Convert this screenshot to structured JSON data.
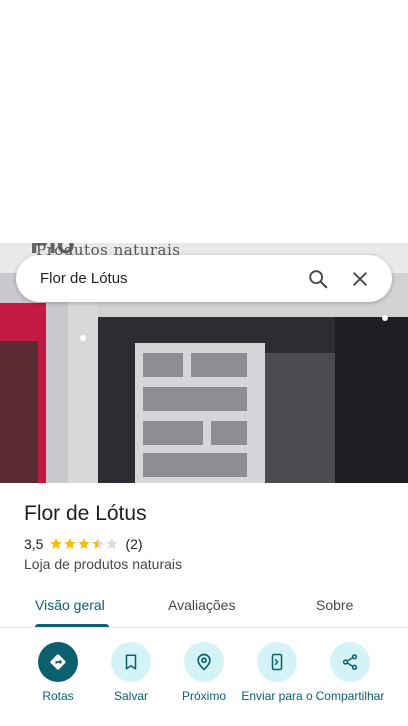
{
  "search": {
    "query": "Flor de Lótus"
  },
  "photo": {
    "sign_text": "Produtos naturais"
  },
  "place": {
    "name": "Flor de Lótus",
    "rating": "3,5",
    "rating_value": 3.5,
    "reviews_count": "(2)",
    "category": "Loja de produtos naturais"
  },
  "tabs": [
    {
      "label": "Visão geral",
      "active": true
    },
    {
      "label": "Avaliações",
      "active": false
    },
    {
      "label": "Sobre",
      "active": false
    }
  ],
  "actions": [
    {
      "label": "Rotas",
      "icon": "directions-icon"
    },
    {
      "label": "Salvar",
      "icon": "bookmark-icon"
    },
    {
      "label": "Próximo",
      "icon": "nearby-icon"
    },
    {
      "label": "Enviar para o",
      "icon": "send-to-phone-icon"
    },
    {
      "label": "Compartilhar",
      "icon": "share-icon"
    }
  ],
  "colors": {
    "accent": "#0b5f6e",
    "accent_light": "#d3f3f7",
    "star": "#fbbc04",
    "star_empty": "#dadce0"
  }
}
